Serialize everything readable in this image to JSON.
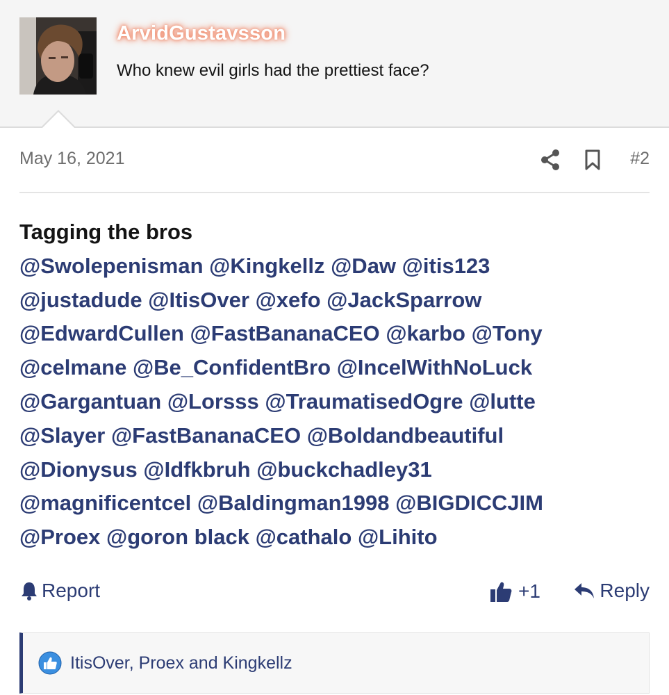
{
  "user": {
    "name": "ArvidGustavsson",
    "title": "Who knew evil girls had the prettiest face?"
  },
  "post": {
    "date": "May 16, 2021",
    "number": "#2",
    "intro": "Tagging the bros",
    "mention_lines": [
      [
        "@Swolepenisman",
        "@Kingkellz",
        "@Daw",
        "@itis123"
      ],
      [
        "@justadude",
        "@ItisOver",
        "@xefo",
        "@JackSparrow"
      ],
      [
        "@EdwardCullen",
        "@FastBananaCEO",
        "@karbo",
        "@Tony"
      ],
      [
        "@celmane",
        "@Be_ConfidentBro",
        "@IncelWithNoLuck"
      ],
      [
        "@Gargantuan",
        "@Lorsss",
        "@TraumatisedOgre",
        "@lutte"
      ],
      [
        "@Slayer",
        "@FastBananaCEO",
        "@Boldandbeautiful"
      ],
      [
        "@Dionysus",
        "@Idfkbruh",
        "@buckchadley31"
      ],
      [
        "@magnificentcel",
        "@Baldingman1998",
        "@BIGDICCJIM"
      ],
      [
        "@Proex",
        "@goron black",
        "@cathalo",
        "@Lihito"
      ]
    ]
  },
  "actions": {
    "report_label": "Report",
    "like_label": "+1",
    "reply_label": "Reply"
  },
  "reactions": {
    "text": "ItisOver, Proex and Kingkellz"
  },
  "icons": {
    "share": "share-icon",
    "bookmark": "bookmark-icon",
    "report": "bell-icon",
    "like": "thumbs-up-icon",
    "reply": "reply-arrow-icon",
    "reaction": "like-reaction-icon"
  },
  "colors": {
    "link": "#2c3c74",
    "username_glow": "#f08a6a",
    "header_bg": "#f5f5f5",
    "reaction_badge": "#3b8fe0"
  }
}
